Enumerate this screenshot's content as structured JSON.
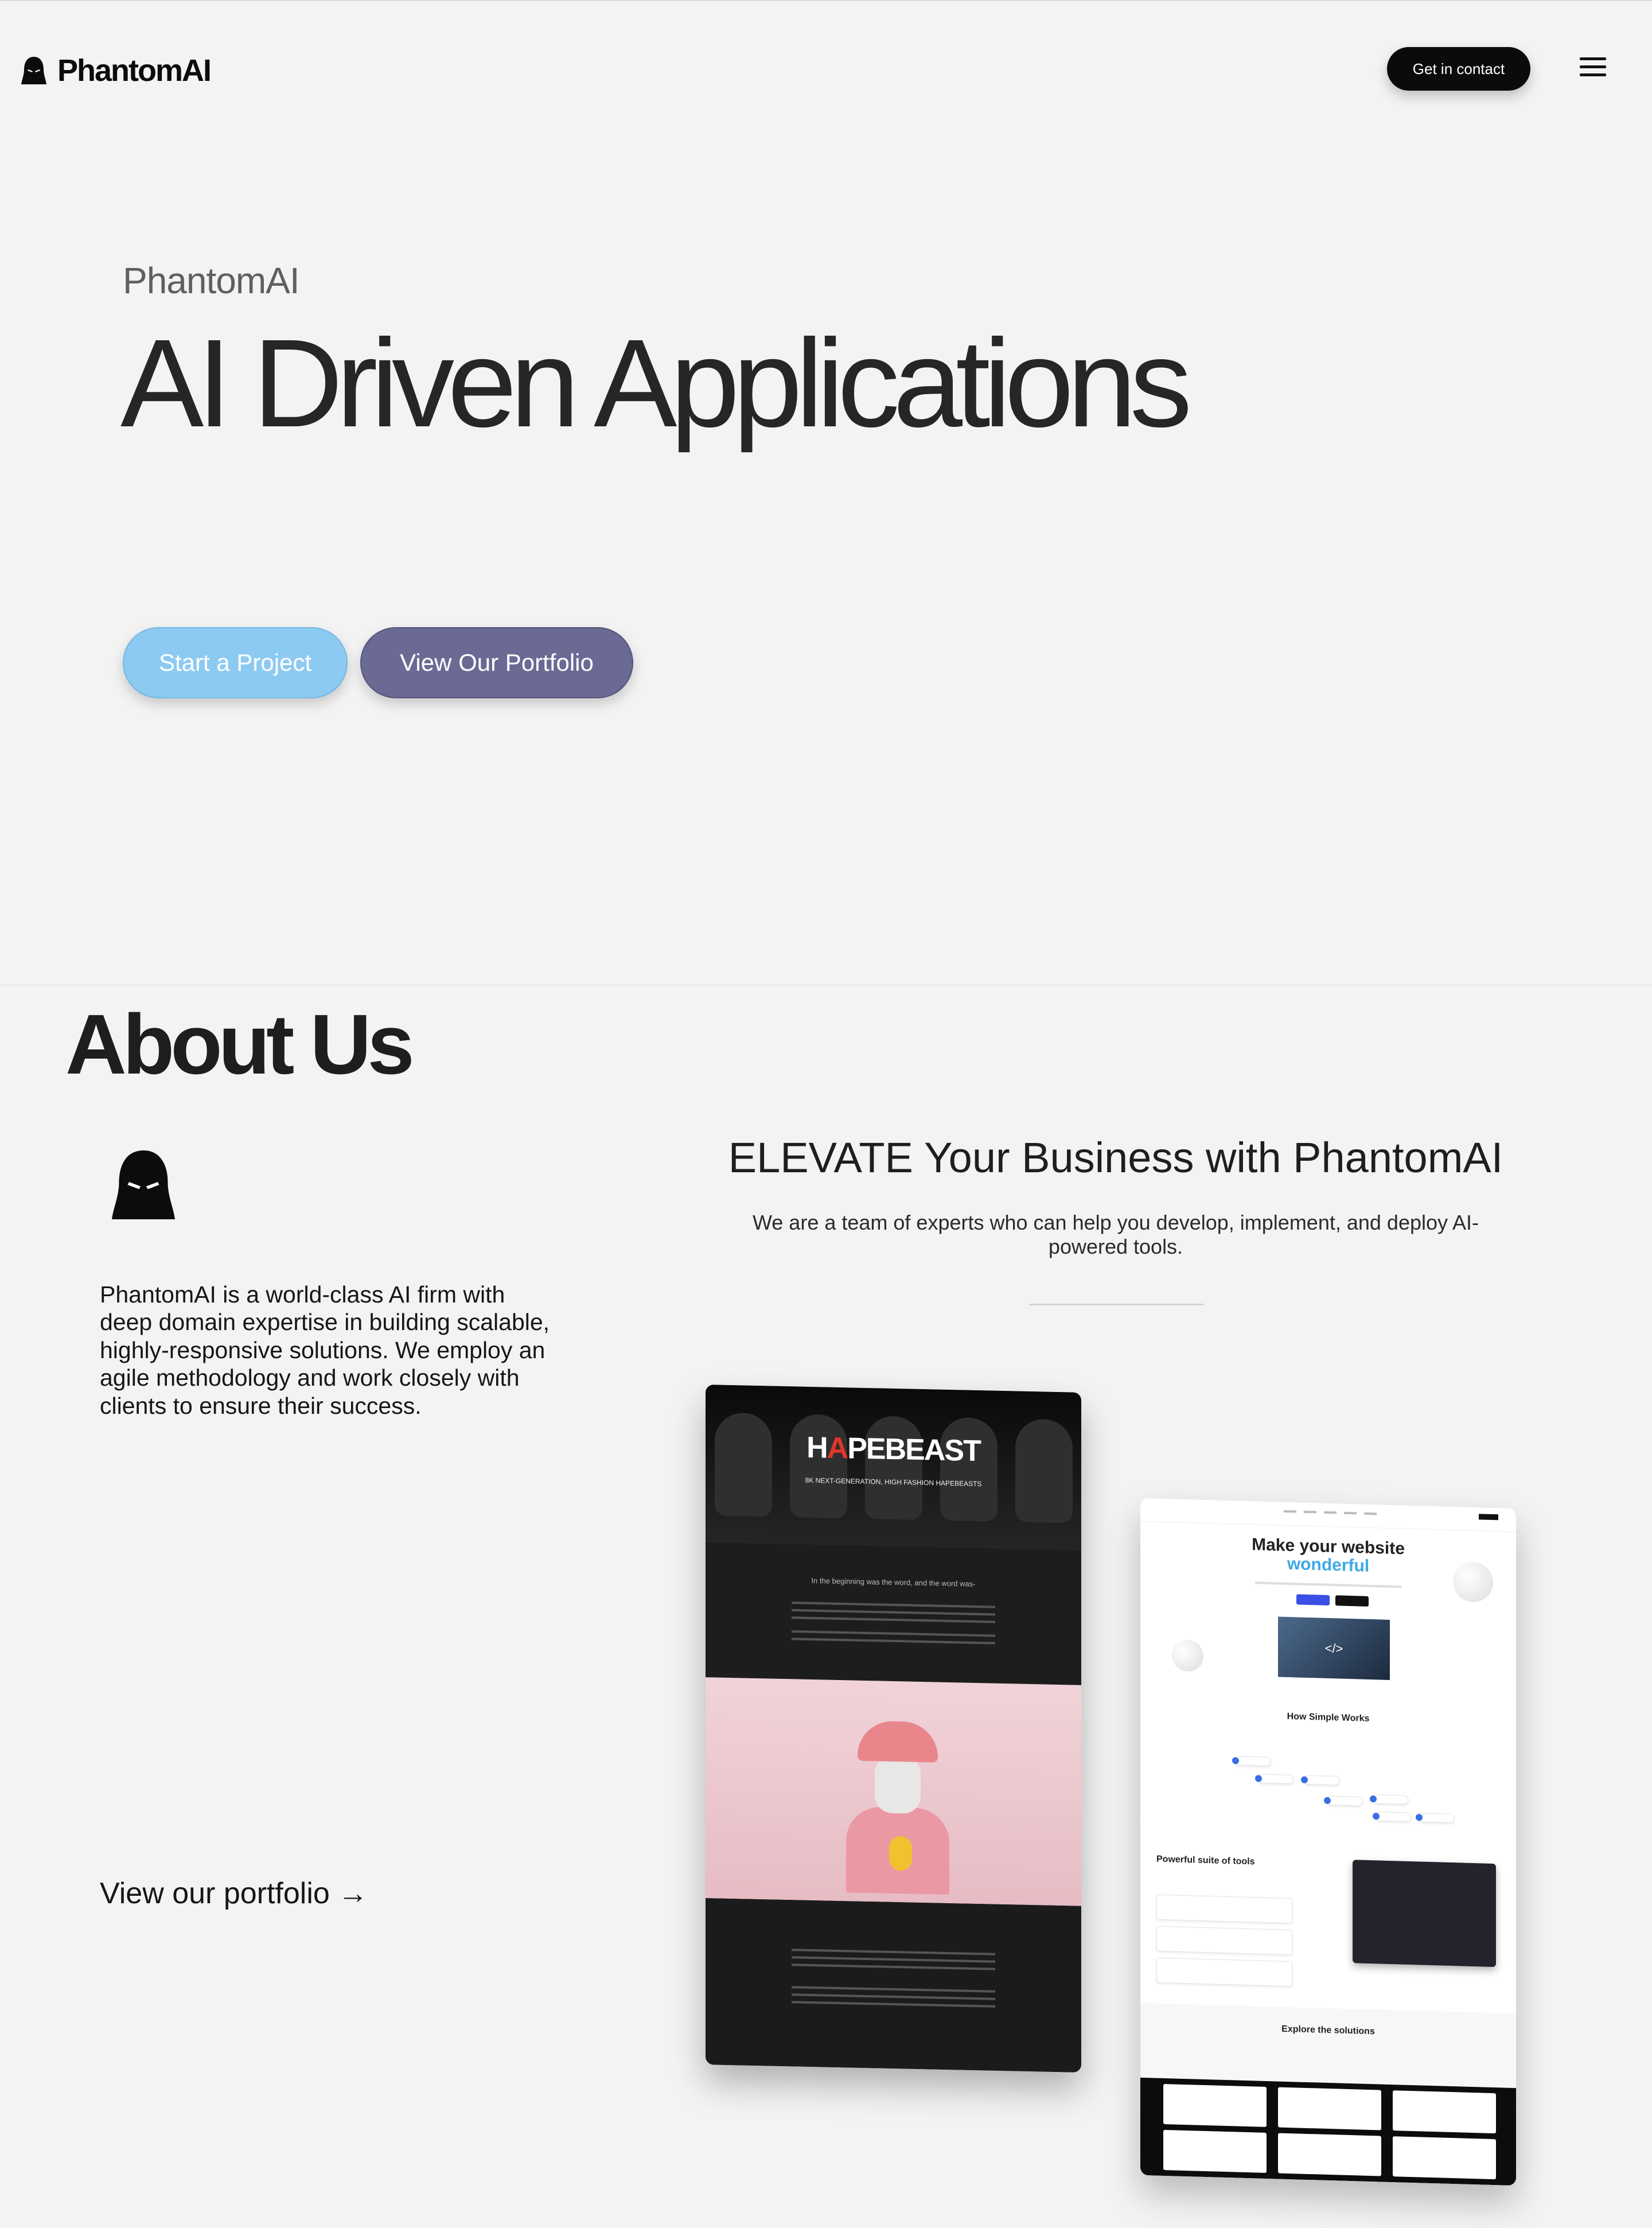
{
  "header": {
    "logo_text": "PhantomAI",
    "logo_icon": "ghost-hood-icon",
    "contact_label": "Get in contact",
    "menu_icon": "hamburger-menu-icon"
  },
  "hero": {
    "eyebrow": "PhantomAI",
    "title": "AI Driven Applications",
    "start_label": "Start a Project",
    "portfolio_label": "View Our Portfolio"
  },
  "about": {
    "title": "About Us",
    "icon": "ghost-hood-icon",
    "description": "PhantomAI is a world-class AI firm with deep domain expertise in building scalable, highly-responsive solutions. We employ an agile methodology and work closely with clients to ensure their success.",
    "portfolio_link": "View our portfolio →",
    "heading": "ELEVATE Your Business with PhantomAI",
    "subheading": "We are a team of experts who can help you develop, implement, and deploy AI-powered tools."
  },
  "mockup_hapebeast": {
    "brand_prefix": "H",
    "brand_accent": "A",
    "brand_suffix": "PEBEAST",
    "tagline": "8K NEXT-GENERATION, HIGH FASHION HAPEBEASTS",
    "intro_line": "In the beginning was the word, and the word was-"
  },
  "mockup_website": {
    "headline": "Make your website",
    "headline_accent": "wonderful",
    "image_glyph": "</>",
    "section_how": "How Simple Works",
    "section_tools": "Powerful suite of tools",
    "section_explore": "Explore the solutions"
  },
  "colors": {
    "background": "#f3f3f3",
    "start_button": "#8ccaf2",
    "portfolio_button": "#6b6a94",
    "contact_button": "#0b0b0b"
  }
}
